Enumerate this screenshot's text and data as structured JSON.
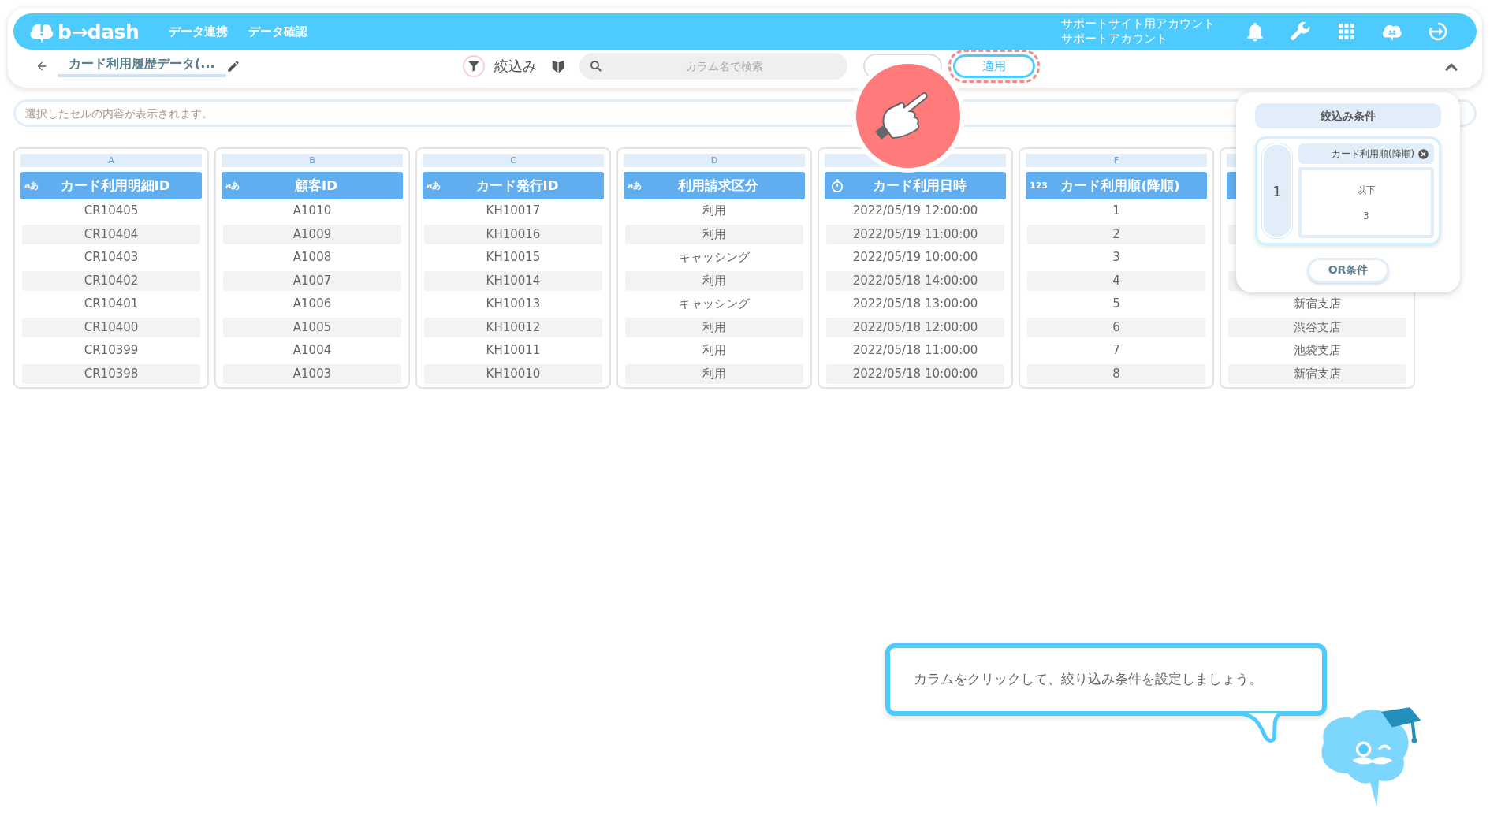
{
  "header": {
    "logo": "b→dash",
    "nav": [
      "データ連携",
      "データ確認"
    ],
    "account": [
      "サポートサイト用アカウント",
      "サポートアカウント"
    ]
  },
  "toolbar": {
    "title": "カード利用履歴データ(...",
    "filter_label": "絞込み",
    "search": {
      "placeholder": "カラム名で検索"
    },
    "apply": "適用"
  },
  "cell_bar": {
    "placeholder": "選択したセルの内容が表示されます。"
  },
  "columns": [
    {
      "letter": "A",
      "kind": "text",
      "type_label": "aあ",
      "name": "カード利用明細ID",
      "cells": [
        "CR10405",
        "CR10404",
        "CR10403",
        "CR10402",
        "CR10401",
        "CR10400",
        "CR10399",
        "CR10398"
      ]
    },
    {
      "letter": "B",
      "kind": "text",
      "type_label": "aあ",
      "name": "顧客ID",
      "cells": [
        "A1010",
        "A1009",
        "A1008",
        "A1007",
        "A1006",
        "A1005",
        "A1004",
        "A1003"
      ]
    },
    {
      "letter": "C",
      "kind": "text",
      "type_label": "aあ",
      "name": "カード発行ID",
      "cells": [
        "KH10017",
        "KH10016",
        "KH10015",
        "KH10014",
        "KH10013",
        "KH10012",
        "KH10011",
        "KH10010"
      ]
    },
    {
      "letter": "D",
      "kind": "text",
      "type_label": "aあ",
      "name": "利用請求区分",
      "cells": [
        "利用",
        "利用",
        "キャッシング",
        "利用",
        "キャッシング",
        "利用",
        "利用",
        "利用"
      ]
    },
    {
      "kind": "datetime",
      "name": "カード利用日時",
      "cells": [
        "2022/05/19 12:00:00",
        "2022/05/19 11:00:00",
        "2022/05/19 10:00:00",
        "2022/05/18 14:00:00",
        "2022/05/18 13:00:00",
        "2022/05/18 12:00:00",
        "2022/05/18 11:00:00",
        "2022/05/18 10:00:00"
      ]
    },
    {
      "letter": "F",
      "kind": "number",
      "type_label": "123",
      "name": "カード利用順(降順)",
      "cells": [
        "1",
        "2",
        "3",
        "4",
        "5",
        "6",
        "7",
        "8"
      ]
    },
    {
      "kind": "text",
      "cells": [
        null,
        null,
        null,
        null,
        "新宿支店",
        "渋谷支店",
        "池袋支店",
        "新宿支店"
      ]
    }
  ],
  "filter_panel": {
    "title": "絞込み条件",
    "groups": [
      {
        "number": "1",
        "column": "カード利用順(降順)",
        "operator": "以下",
        "value": "3"
      }
    ],
    "or_button": "OR条件"
  },
  "guide": {
    "message": "カラムをクリックして、絞り込み条件を設定しましょう。"
  }
}
